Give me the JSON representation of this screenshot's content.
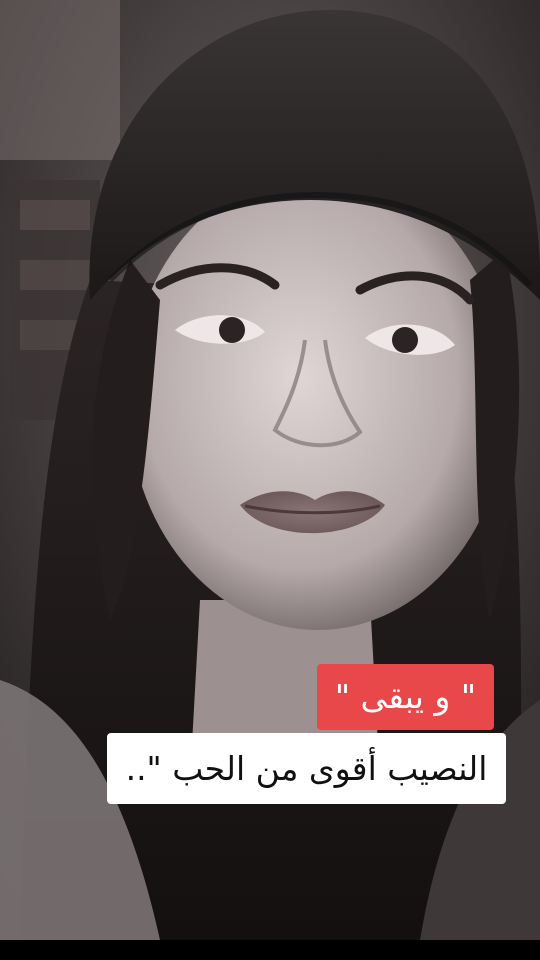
{
  "caption": {
    "line1": "\" و يبقى \"",
    "line2": "النصيب أقوى من الحب \"..",
    "line1_bg": "#e8484a",
    "line2_bg": "#ffffff"
  },
  "photo": {
    "style": "black-and-white portrait",
    "subject": "woman in beanie"
  }
}
